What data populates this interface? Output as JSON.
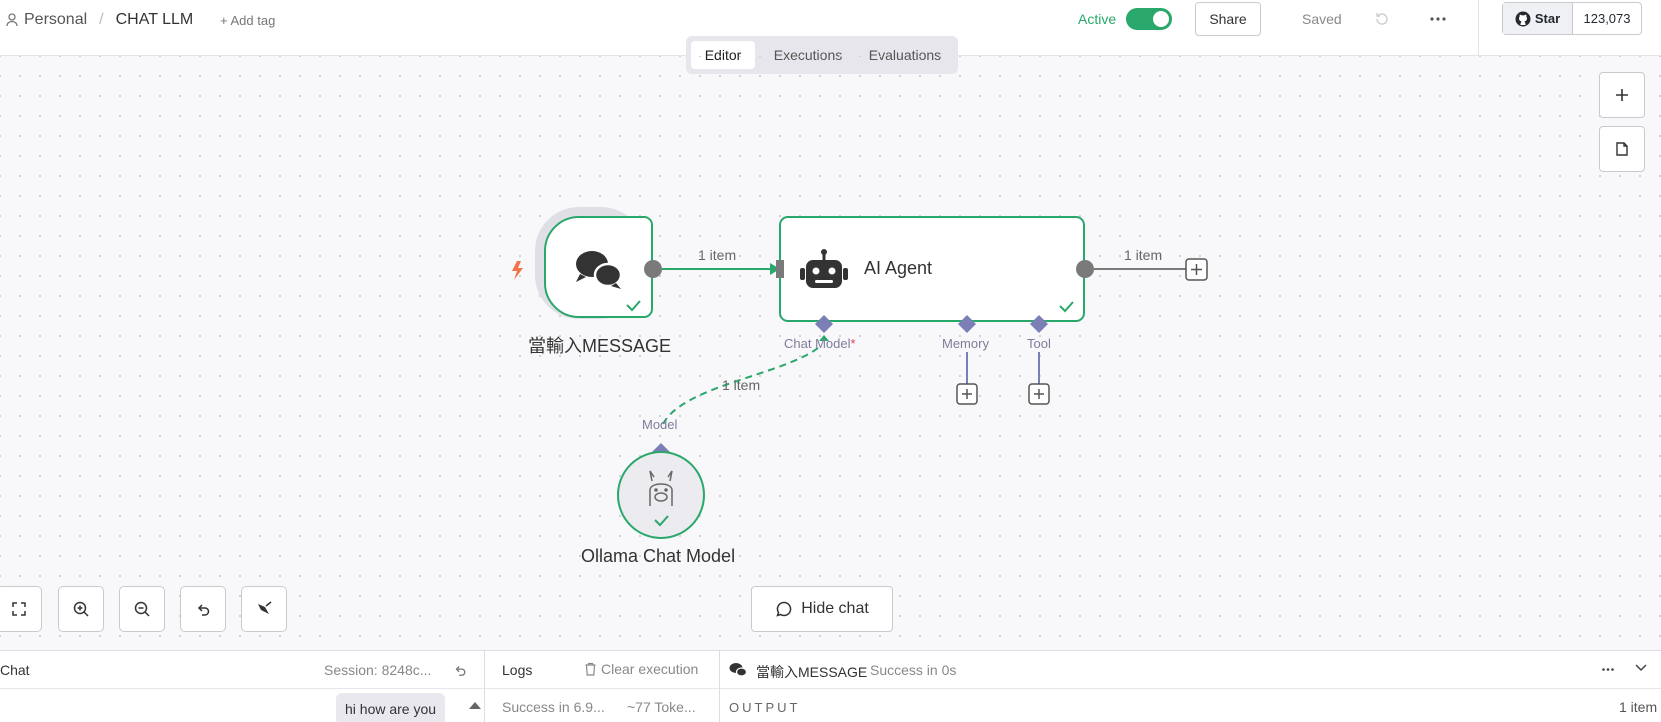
{
  "header": {
    "breadcrumb_project": "Personal",
    "breadcrumb_sep": "/",
    "workflow_name": "CHAT LLM",
    "add_tag": "+ Add tag",
    "active_label": "Active",
    "share_label": "Share",
    "saved_label": "Saved",
    "github_star_label": "Star",
    "github_star_count": "123,073"
  },
  "tabs": [
    {
      "label": "Editor",
      "active": true
    },
    {
      "label": "Executions",
      "active": false
    },
    {
      "label": "Evaluations",
      "active": false
    }
  ],
  "canvas": {
    "trigger_node": {
      "label": "當輸入MESSAGE",
      "icon": "chat-bubbles-icon",
      "status": "success"
    },
    "agent_node": {
      "label": "AI Agent",
      "icon": "robot-icon",
      "status": "success"
    },
    "model_node": {
      "label": "Ollama Chat Model",
      "icon": "llama-icon",
      "status": "success"
    },
    "edge_trigger_agent_label": "1 item",
    "edge_agent_out_label": "1 item",
    "edge_model_label": "1 item",
    "agent_ports": {
      "chat_model": "Chat Model",
      "required_mark": "*",
      "memory": "Memory",
      "tool": "Tool"
    },
    "model_port_label": "Model",
    "hide_chat_label": "Hide chat"
  },
  "bottom_panel": {
    "chat_title": "Chat",
    "session_label": "Session: 8248c...",
    "user_message": "hi how are you",
    "logs_title": "Logs",
    "clear_execution": "Clear execution",
    "log_entry_status": "Success in 6.9...",
    "log_entry_tokens": "~77 Toke...",
    "output_node_name": "當輸入MESSAGE",
    "output_status": "Success in 0s",
    "output_heading": "OUTPUT",
    "output_count": "1 item"
  },
  "colors": {
    "accent_green": "#2aa86b",
    "node_border_green": "#2aa86b",
    "port_purple": "#7b7fb5",
    "trigger_bolt": "#f0734a"
  }
}
